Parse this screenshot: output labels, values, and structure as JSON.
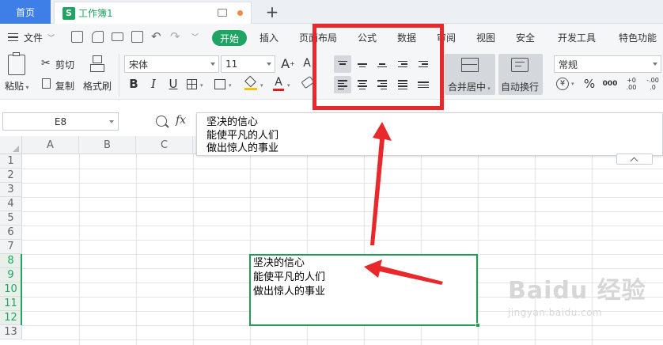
{
  "titlebar": {
    "home_tab": "首页",
    "doc_tab": "工作簿1",
    "doc_icon_letter": "S",
    "add_tab": "+"
  },
  "menu": {
    "file": "文件",
    "items": [
      "开始",
      "插入",
      "页面布局",
      "公式",
      "数据",
      "审阅",
      "视图",
      "安全",
      "开发工具",
      "特色功能"
    ]
  },
  "ribbon": {
    "paste": "粘贴",
    "cut": "剪切",
    "copy": "复制",
    "format_painter": "格式刷",
    "font_name": "宋体",
    "font_size": "11",
    "merge_center": "合并居中",
    "wrap_text": "自动换行",
    "number_format": "常规",
    "bold": "B",
    "italic": "I",
    "underline": "U",
    "font_grow": "A+",
    "font_shrink": "A-",
    "percent": "%",
    "thousands": "000",
    "dec_inc": "+0 .00",
    "dec_dec": "-.00 .0"
  },
  "formula": {
    "cell_ref": "E8",
    "fx": "fx",
    "lines": [
      "坚决的信心",
      "能使平凡的人们",
      "做出惊人的事业"
    ]
  },
  "grid": {
    "columns": [
      "A",
      "B",
      "C"
    ],
    "rows": [
      "1",
      "2",
      "3",
      "4",
      "5",
      "6",
      "7",
      "8",
      "9",
      "10",
      "11",
      "12",
      "13"
    ],
    "active_cell_lines": [
      "坚决的信心",
      "能使平凡的人们",
      "做出惊人的事业"
    ]
  },
  "watermark": {
    "big": "Baidu 经验",
    "small": "jingyan.baidu.com"
  },
  "colors": {
    "accent_green": "#1fa463",
    "highlight_red": "#e8282b",
    "home_blue": "#3d7fe6"
  }
}
